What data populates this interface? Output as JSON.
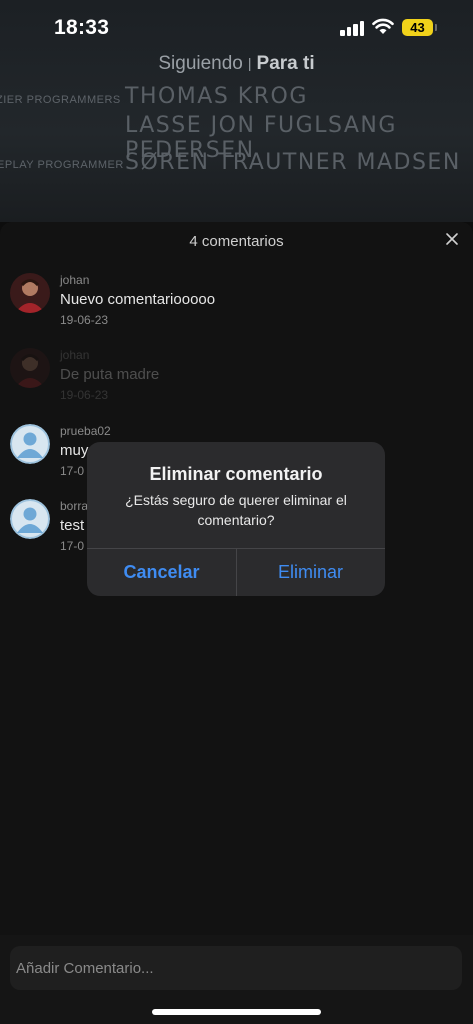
{
  "status_bar": {
    "time": "18:33",
    "battery": "43"
  },
  "feed_tabs": {
    "following": "Siguiendo",
    "separator": "|",
    "for_you": "Para ti"
  },
  "credits": {
    "labels": [
      "ZIER PROGRAMMERS",
      "EPLAY PROGRAMMER"
    ],
    "names": [
      "THOMAS KROG",
      "LASSE JON FUGLSANG PEDERSEN",
      "SØREN TRAUTNER MADSEN"
    ]
  },
  "comments_sheet": {
    "title": "4 comentarios",
    "comments": [
      {
        "user": "johan",
        "text": "Nuevo comentariooooo",
        "date": "19-06-23"
      },
      {
        "user": "johan",
        "text": "De puta madre",
        "date": "19-06-23"
      },
      {
        "user": "prueba02",
        "text": "muy",
        "date": "17-0"
      },
      {
        "user": "borra",
        "text": "test",
        "date": "17-0"
      }
    ]
  },
  "dialog": {
    "title": "Eliminar comentario",
    "message": "¿Estás seguro de querer eliminar el comentario?",
    "cancel": "Cancelar",
    "confirm": "Eliminar"
  },
  "input": {
    "placeholder": "Añadir Comentario..."
  },
  "colors": {
    "accent": "#3f8cf2",
    "battery": "#f1d21a",
    "default_avatar": "#6ea8d6"
  }
}
